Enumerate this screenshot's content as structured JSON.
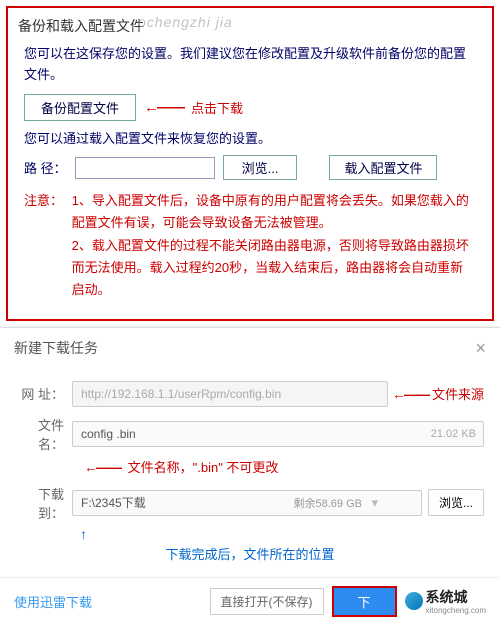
{
  "top": {
    "title": "备份和载入配置文件",
    "watermark": "ochengzhi jia",
    "desc1": "您可以在这保存您的设置。我们建议您在修改配置及升级软件前备份您的配置文件。",
    "backup_btn": "备份配置文件",
    "arrow1": "←——",
    "click_dl": "点击下载",
    "desc2": "您可以通过载入配置文件来恢复您的设置。",
    "path_label": "路 径：",
    "browse": "浏览...",
    "load_btn": "载入配置文件",
    "notice_label": "注意：",
    "notice_body": "1、导入配置文件后，设备中原有的用户配置将会丢失。如果您载入的配置文件有误，可能会导致设备无法被管理。\n2、载入配置文件的过程不能关闭路由器电源，否则将导致路由器损坏而无法使用。载入过程约20秒，当载入结束后，路由器将会自动重新启动。"
  },
  "dialog": {
    "title": "新建下载任务",
    "url_label": "网 址：",
    "url_value": "http://192.168.1.1/userRpm/config.bin",
    "url_ann": "文件来源",
    "name_label": "文件名：",
    "name_value": "config .bin",
    "name_ann": "文件名称，\".bin\" 不可更改",
    "size": "21.02 KB",
    "to_label": "下载到：",
    "to_value": "F:\\2345下载",
    "space": "剩余58.69 GB",
    "browse": "浏览...",
    "to_ann": "下载完成后，文件所在的位置",
    "xunlei": "使用迅雷下载",
    "direct": "直接打开(不保存)",
    "download": "下",
    "logo": "系统城",
    "logo_sub": "xitongcheng.com"
  }
}
